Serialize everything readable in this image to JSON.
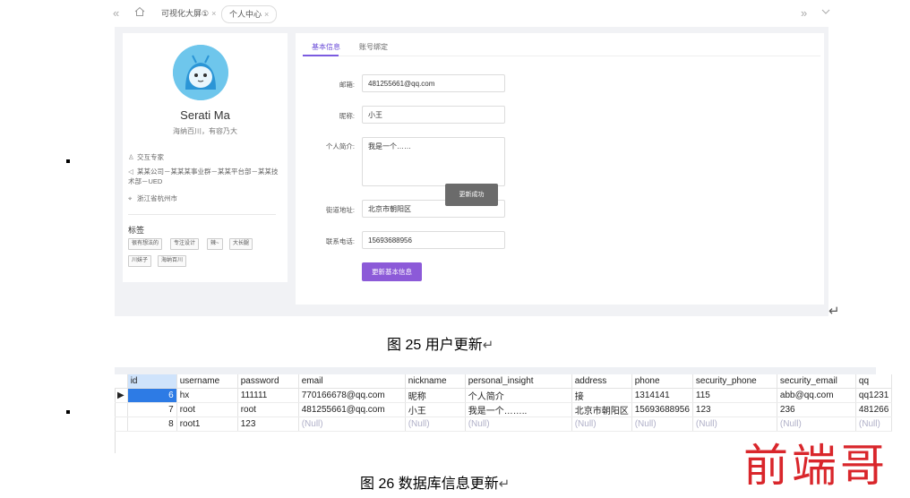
{
  "top_tabs": {
    "back_icon": "double-left-icon",
    "home_icon": "home-icon",
    "items": [
      {
        "label": "可视化大屏①",
        "active": false
      },
      {
        "label": "个人中心",
        "active": true
      }
    ]
  },
  "profile": {
    "name": "Serati Ma",
    "motto": "海纳百川，有容乃大",
    "info": [
      {
        "icon": "user-icon",
        "text": "交互专家"
      },
      {
        "icon": "cluster-icon",
        "text": "某某公司－某某某事业群－某某平台部－某某技术部－UED"
      },
      {
        "icon": "location-icon",
        "text": "浙江省杭州市"
      }
    ],
    "tags_title": "标签",
    "tags": [
      "很有想法的",
      "专注设计",
      "辣~",
      "大长腿",
      "川妹子",
      "海纳百川"
    ]
  },
  "settings": {
    "tabs": [
      "基本信息",
      "账号绑定"
    ],
    "fields": [
      {
        "label": "邮箱:",
        "value": "481255661@qq.com"
      },
      {
        "label": "昵称:",
        "value": "小王"
      },
      {
        "label": "个人简介:",
        "value": "我是一个……"
      },
      {
        "label": "街道地址:",
        "value": "北京市朝阳区"
      },
      {
        "label": "联系电话:",
        "value": "15693688956"
      }
    ],
    "toast": "更新成功",
    "save_label": "更新基本信息"
  },
  "caption1": {
    "text": "图 25 用户更新"
  },
  "caption2": {
    "text": "图 26 数据库信息更新"
  },
  "db_table": {
    "columns": [
      "id",
      "username",
      "password",
      "email",
      "nickname",
      "personal_insight",
      "address",
      "phone",
      "security_phone",
      "security_email",
      "qq"
    ],
    "rows": [
      [
        "6",
        "hx",
        "111111",
        "770166678@qq.com",
        "昵称",
        "个人简介",
        "接",
        "1314141",
        "115",
        "abb@qq.com",
        "qq1231"
      ],
      [
        "7",
        "root",
        "root",
        "481255661@qq.com",
        "小王",
        "我是一个……..",
        "北京市朝阳区",
        "15693688956",
        "123",
        "236",
        "481266"
      ],
      [
        "8",
        "root1",
        "123",
        "(Null)",
        "(Null)",
        "(Null)",
        "(Null)",
        "(Null)",
        "(Null)",
        "(Null)",
        "(Null)"
      ]
    ]
  },
  "watermark": "前端哥"
}
